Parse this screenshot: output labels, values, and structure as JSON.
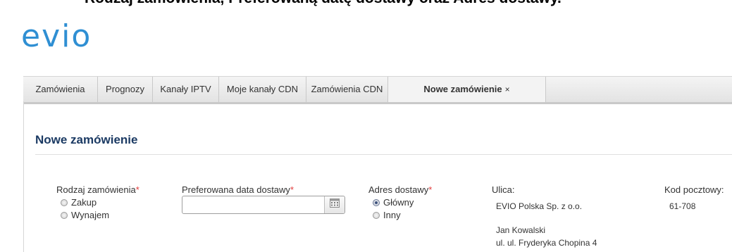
{
  "caption": "Rodzaj zamówienia, Preferowaną datę dostawy oraz Adres dostawy.",
  "logo": "evio",
  "tabs": [
    {
      "label": "Zamówienia"
    },
    {
      "label": "Prognozy"
    },
    {
      "label": "Kanały IPTV"
    },
    {
      "label": "Moje kanały CDN"
    },
    {
      "label": "Zamówienia CDN"
    },
    {
      "label": "Nowe zamówienie",
      "close": "×",
      "active": true
    }
  ],
  "page_title": "Nowe zamówienie",
  "form": {
    "order_type": {
      "label": "Rodzaj zamówienia",
      "required_mark": "*",
      "options": [
        "Zakup",
        "Wynajem"
      ],
      "selected": null
    },
    "delivery_date": {
      "label": "Preferowana data dostawy",
      "required_mark": "*",
      "value": "",
      "placeholder": ""
    },
    "delivery_address": {
      "label": "Adres dostawy",
      "required_mark": "*",
      "options": [
        "Główny",
        "Inny"
      ],
      "selected": "Główny"
    },
    "street": {
      "label": "Ulica:",
      "company": "EVIO Polska Sp. z o.o.",
      "person": "Jan Kowalski",
      "street_line": "ul. ul. Fryderyka Chopina 4"
    },
    "postal": {
      "label": "Kod pocztowy:",
      "value": "61-708"
    }
  },
  "colors": {
    "logo": "#2f8fd3",
    "title": "#1b3a63",
    "required": "#e23b3b"
  },
  "icons": {
    "calendar": "calendar-icon",
    "close": "close-icon"
  }
}
